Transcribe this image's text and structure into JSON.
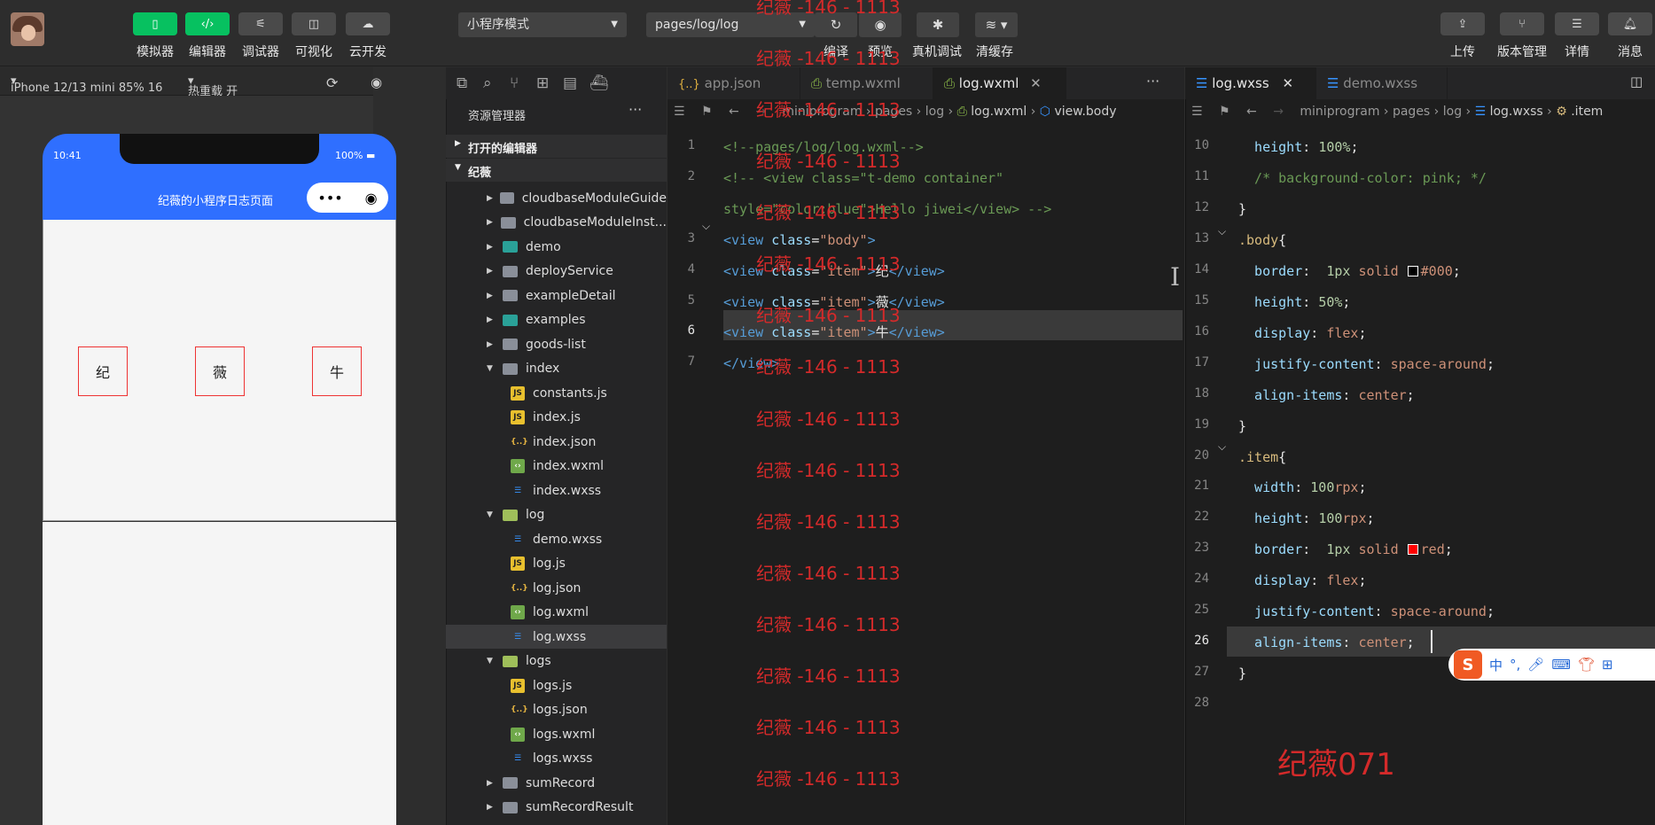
{
  "toolbar": {
    "left_buttons": [
      {
        "icon": "phone-icon",
        "label": "模拟器"
      },
      {
        "icon": "code-icon",
        "label": "编辑器"
      },
      {
        "icon": "debug-sliders-icon",
        "label": "调试器"
      },
      {
        "icon": "layout-icon",
        "label": "可视化"
      },
      {
        "icon": "cloud-icon",
        "label": "云开发"
      }
    ],
    "mode_select": "小程序模式",
    "page_select": "pages/log/log",
    "mid_actions": [
      {
        "icon": "refresh-icon",
        "label": "编译"
      },
      {
        "icon": "eye-icon",
        "label": "预览"
      },
      {
        "icon": "bug-icon",
        "label": "真机调试"
      },
      {
        "icon": "layers-icon",
        "label": "清缓存"
      }
    ],
    "right_buttons": [
      {
        "icon": "upload-icon",
        "label": "上传"
      },
      {
        "icon": "branch-icon",
        "label": "版本管理"
      },
      {
        "icon": "menu-icon",
        "label": "详情"
      },
      {
        "icon": "bell-icon",
        "label": "消息"
      }
    ]
  },
  "simulator": {
    "device": "iPhone 12/13 mini 85% 16",
    "hot_reload": "热重载 开",
    "time": "10:41",
    "battery": "100%",
    "nav_title": "纪薇的小程序日志页面",
    "items": [
      "纪",
      "薇",
      "牛"
    ]
  },
  "explorer": {
    "title": "资源管理器",
    "open_editors": "打开的编辑器",
    "project": "纪薇",
    "tree": [
      {
        "name": "cloudbaseModuleGuide",
        "type": "folder",
        "indent": 0,
        "open": false
      },
      {
        "name": "cloudbaseModuleInst...",
        "type": "folder",
        "indent": 0,
        "open": false
      },
      {
        "name": "demo",
        "type": "folder-teal",
        "indent": 0,
        "open": false
      },
      {
        "name": "deployService",
        "type": "folder",
        "indent": 0,
        "open": false
      },
      {
        "name": "exampleDetail",
        "type": "folder",
        "indent": 0,
        "open": false
      },
      {
        "name": "examples",
        "type": "folder-teal",
        "indent": 0,
        "open": false
      },
      {
        "name": "goods-list",
        "type": "folder",
        "indent": 0,
        "open": false
      },
      {
        "name": "index",
        "type": "folder",
        "indent": 0,
        "open": true
      },
      {
        "name": "constants.js",
        "type": "js",
        "indent": 1
      },
      {
        "name": "index.js",
        "type": "js",
        "indent": 1
      },
      {
        "name": "index.json",
        "type": "json",
        "indent": 1
      },
      {
        "name": "index.wxml",
        "type": "wxml",
        "indent": 1
      },
      {
        "name": "index.wxss",
        "type": "wxss",
        "indent": 1
      },
      {
        "name": "log",
        "type": "folder-green",
        "indent": 0,
        "open": true
      },
      {
        "name": "demo.wxss",
        "type": "wxss",
        "indent": 1
      },
      {
        "name": "log.js",
        "type": "js",
        "indent": 1
      },
      {
        "name": "log.json",
        "type": "json",
        "indent": 1
      },
      {
        "name": "log.wxml",
        "type": "wxml",
        "indent": 1
      },
      {
        "name": "log.wxss",
        "type": "wxss",
        "indent": 1,
        "selected": true
      },
      {
        "name": "logs",
        "type": "folder-green",
        "indent": 0,
        "open": true
      },
      {
        "name": "logs.js",
        "type": "js",
        "indent": 1
      },
      {
        "name": "logs.json",
        "type": "json",
        "indent": 1
      },
      {
        "name": "logs.wxml",
        "type": "wxml",
        "indent": 1
      },
      {
        "name": "logs.wxss",
        "type": "wxss",
        "indent": 1
      },
      {
        "name": "sumRecord",
        "type": "folder",
        "indent": 0,
        "open": false
      },
      {
        "name": "sumRecordResult",
        "type": "folder",
        "indent": 0,
        "open": false
      }
    ]
  },
  "editor1": {
    "tabs": [
      {
        "icon": "{..}",
        "name": "app.json",
        "active": false
      },
      {
        "icon": "wxml",
        "name": "temp.wxml",
        "active": false
      },
      {
        "icon": "wxml",
        "name": "log.wxml",
        "active": true
      }
    ],
    "breadcrumb": [
      "miniprogram",
      "pages",
      "log",
      "log.wxml",
      "view.body"
    ],
    "line_numbers": [
      "1",
      "2",
      "",
      "3",
      "4",
      "5",
      "6",
      "7"
    ],
    "current_line": "6",
    "lines": [
      [
        {
          "c": "cm",
          "t": "<!--pages/log/log.wxml-->"
        }
      ],
      [
        {
          "c": "cm",
          "t": "<!-- <view class=\"t-demo container\""
        }
      ],
      [
        {
          "c": "cm",
          "t": "style=\"color:blue\">Hello jiwei</view> -->"
        }
      ],
      [
        {
          "c": "tg",
          "t": "<view "
        },
        {
          "c": "at",
          "t": "class"
        },
        {
          "c": "tx",
          "t": "="
        },
        {
          "c": "sv",
          "t": "\"body\""
        },
        {
          "c": "tg",
          "t": ">"
        }
      ],
      [
        {
          "c": "tg",
          "t": "<view "
        },
        {
          "c": "at",
          "t": "class"
        },
        {
          "c": "tx",
          "t": "="
        },
        {
          "c": "sv",
          "t": "\"item\""
        },
        {
          "c": "tg",
          "t": ">"
        },
        {
          "c": "tx",
          "t": "纪"
        },
        {
          "c": "tg",
          "t": "</view>"
        }
      ],
      [
        {
          "c": "tg",
          "t": "<view "
        },
        {
          "c": "at",
          "t": "class"
        },
        {
          "c": "tx",
          "t": "="
        },
        {
          "c": "sv",
          "t": "\"item\""
        },
        {
          "c": "tg",
          "t": ">"
        },
        {
          "c": "tx",
          "t": "薇"
        },
        {
          "c": "tg",
          "t": "</view>"
        }
      ],
      [
        {
          "c": "tg",
          "t": "<view "
        },
        {
          "c": "at",
          "t": "class"
        },
        {
          "c": "tx",
          "t": "="
        },
        {
          "c": "sv",
          "t": "\"item\""
        },
        {
          "c": "tg",
          "t": ">"
        },
        {
          "c": "tx",
          "t": "牛"
        },
        {
          "c": "tg",
          "t": "</view>"
        }
      ],
      [
        {
          "c": "tg",
          "t": "</view>"
        }
      ]
    ]
  },
  "watermark": "纪薇 -146 - 1113",
  "editor2": {
    "tabs": [
      {
        "name": "log.wxss",
        "active": true
      },
      {
        "name": "demo.wxss",
        "active": false
      }
    ],
    "breadcrumb": [
      "miniprogram",
      "pages",
      "log",
      "log.wxss",
      ".item"
    ],
    "line_numbers": [
      "10",
      "11",
      "12",
      "13",
      "14",
      "15",
      "16",
      "17",
      "18",
      "19",
      "20",
      "21",
      "22",
      "23",
      "24",
      "25",
      "26",
      "27",
      "28"
    ],
    "current_line": "26",
    "lines": [
      [
        {
          "c": "pr",
          "t": "  height"
        },
        {
          "c": "tx",
          "t": ": "
        },
        {
          "c": "nm",
          "t": "100%"
        },
        {
          "c": "tx",
          "t": ";"
        }
      ],
      [
        {
          "c": "cm",
          "t": "  /* background-color: pink; */"
        }
      ],
      [
        {
          "c": "tx",
          "t": "}"
        }
      ],
      [
        {
          "c": "sel1",
          "t": ".body"
        },
        {
          "c": "tx",
          "t": "{"
        }
      ],
      [
        {
          "c": "pr",
          "t": "  border"
        },
        {
          "c": "tx",
          "t": ":  "
        },
        {
          "c": "nm",
          "t": "1px"
        },
        {
          "c": "pv",
          "t": " solid "
        },
        {
          "c": "sw-black",
          "t": " "
        },
        {
          "c": "pv",
          "t": "#000"
        },
        {
          "c": "tx",
          "t": ";"
        }
      ],
      [
        {
          "c": "pr",
          "t": "  height"
        },
        {
          "c": "tx",
          "t": ": "
        },
        {
          "c": "nm",
          "t": "50%"
        },
        {
          "c": "tx",
          "t": ";"
        }
      ],
      [
        {
          "c": "pr",
          "t": "  display"
        },
        {
          "c": "tx",
          "t": ": "
        },
        {
          "c": "pv",
          "t": "flex"
        },
        {
          "c": "tx",
          "t": ";"
        }
      ],
      [
        {
          "c": "pr",
          "t": "  justify-content"
        },
        {
          "c": "tx",
          "t": ": "
        },
        {
          "c": "pv",
          "t": "space-around"
        },
        {
          "c": "tx",
          "t": ";"
        }
      ],
      [
        {
          "c": "pr",
          "t": "  align-items"
        },
        {
          "c": "tx",
          "t": ": "
        },
        {
          "c": "pv",
          "t": "center"
        },
        {
          "c": "tx",
          "t": ";"
        }
      ],
      [
        {
          "c": "tx",
          "t": "}"
        }
      ],
      [
        {
          "c": "sel1",
          "t": ".item"
        },
        {
          "c": "tx",
          "t": "{"
        }
      ],
      [
        {
          "c": "pr",
          "t": "  width"
        },
        {
          "c": "tx",
          "t": ": "
        },
        {
          "c": "nm",
          "t": "100"
        },
        {
          "c": "pv",
          "t": "rpx"
        },
        {
          "c": "tx",
          "t": ";"
        }
      ],
      [
        {
          "c": "pr",
          "t": "  height"
        },
        {
          "c": "tx",
          "t": ": "
        },
        {
          "c": "nm",
          "t": "100"
        },
        {
          "c": "pv",
          "t": "rpx"
        },
        {
          "c": "tx",
          "t": ";"
        }
      ],
      [
        {
          "c": "pr",
          "t": "  border"
        },
        {
          "c": "tx",
          "t": ":  "
        },
        {
          "c": "nm",
          "t": "1px"
        },
        {
          "c": "pv",
          "t": " solid "
        },
        {
          "c": "sw-red",
          "t": " "
        },
        {
          "c": "pv",
          "t": "red"
        },
        {
          "c": "tx",
          "t": ";"
        }
      ],
      [
        {
          "c": "pr",
          "t": "  display"
        },
        {
          "c": "tx",
          "t": ": "
        },
        {
          "c": "pv",
          "t": "flex"
        },
        {
          "c": "tx",
          "t": ";"
        }
      ],
      [
        {
          "c": "pr",
          "t": "  justify-content"
        },
        {
          "c": "tx",
          "t": ": "
        },
        {
          "c": "pv",
          "t": "space-around"
        },
        {
          "c": "tx",
          "t": ";"
        }
      ],
      [
        {
          "c": "pr",
          "t": "  align-items"
        },
        {
          "c": "tx",
          "t": ": "
        },
        {
          "c": "pv",
          "t": "center"
        },
        {
          "c": "tx",
          "t": ";"
        }
      ],
      [
        {
          "c": "tx",
          "t": "}"
        }
      ],
      []
    ]
  },
  "ime": {
    "logo": "S",
    "mode": "中",
    "punct": "°,"
  },
  "big_watermark": "纪薇071",
  "colors": {
    "accent_green": "#07c160",
    "nav_blue": "#2f6fff",
    "item_border": "#e33",
    "watermark_red": "#d42a2a"
  }
}
